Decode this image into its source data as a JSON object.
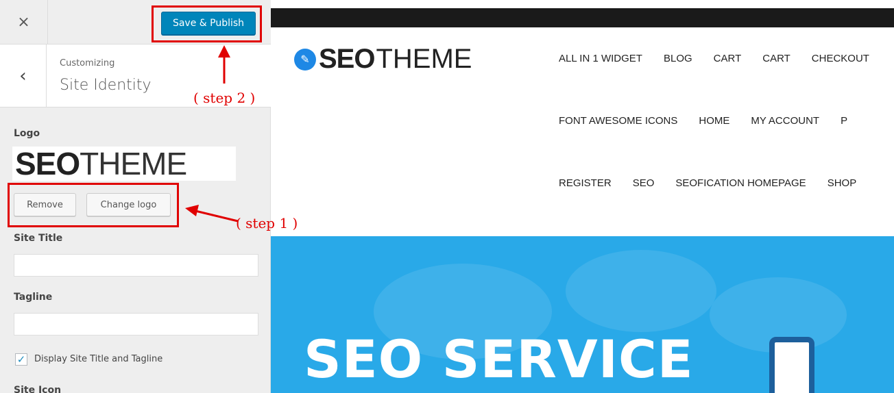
{
  "header": {
    "close_icon": "×",
    "save_label": "Save & Publish"
  },
  "section": {
    "back_icon": "‹",
    "customizing": "Customizing",
    "title": "Site Identity"
  },
  "controls": {
    "logo_label": "Logo",
    "logo_text_bold": "SEO",
    "logo_text_light": "THEME",
    "remove_label": "Remove",
    "change_logo_label": "Change logo",
    "site_title_label": "Site Title",
    "site_title_value": "",
    "tagline_label": "Tagline",
    "tagline_value": "",
    "display_checkbox_checked": true,
    "display_checkbox_label": "Display Site Title and Tagline",
    "site_icon_label": "Site Icon"
  },
  "preview": {
    "logo_badge_icon": "pencil-icon",
    "logo_bold": "SEO",
    "logo_light": "THEME",
    "nav_rows": [
      [
        "ALL IN 1 WIDGET",
        "BLOG",
        "CART",
        "CART",
        "CHECKOUT"
      ],
      [
        "FONT AWESOME ICONS",
        "HOME",
        "MY ACCOUNT",
        "P"
      ],
      [
        "REGISTER",
        "SEO",
        "SEOFICATION HOMEPAGE",
        "SHOP"
      ]
    ],
    "hero_title": "SEO SERVICE",
    "hero_color": "#29a9e8"
  },
  "annotations": {
    "step1": "( step 1 )",
    "step2": "( step 2 )",
    "color": "#e00000"
  }
}
